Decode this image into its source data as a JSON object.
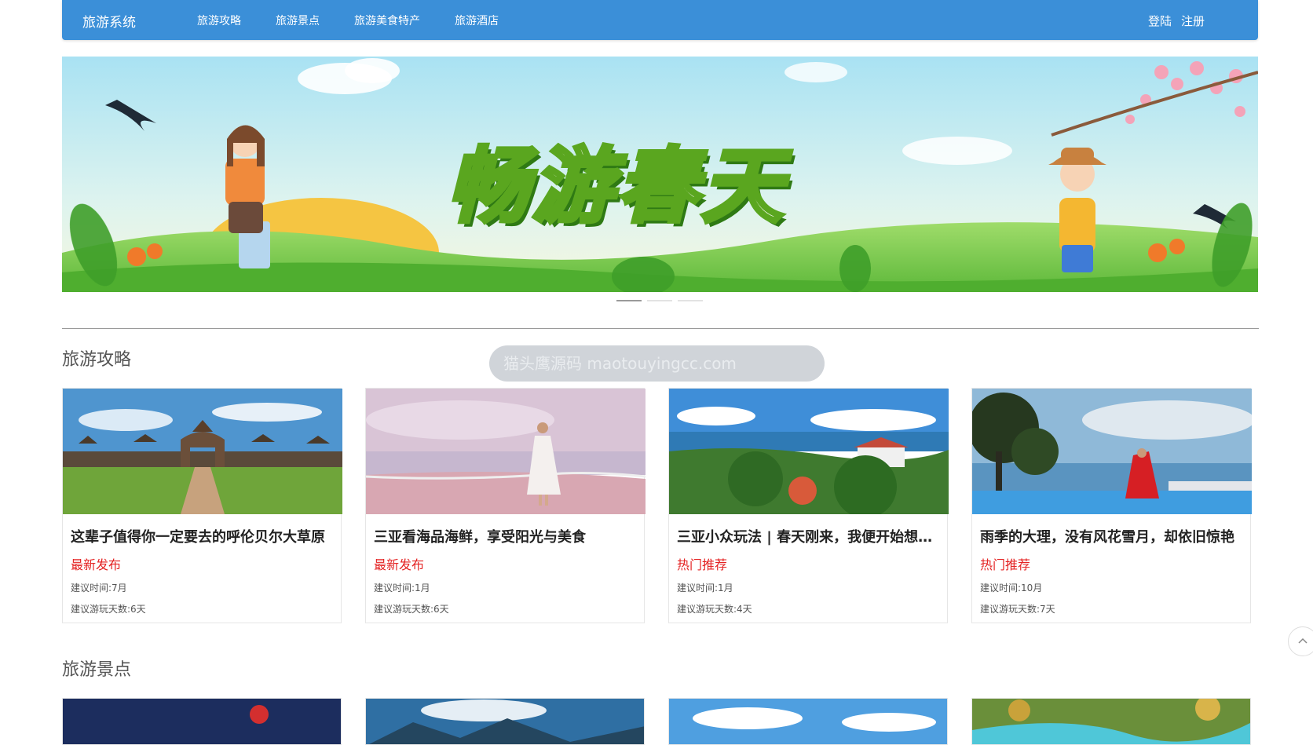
{
  "nav": {
    "brand": "旅游系统",
    "links": [
      "旅游攻略",
      "旅游景点",
      "旅游美食特产",
      "旅游酒店"
    ],
    "login": "登陆",
    "register": "注册"
  },
  "banner": {
    "headline": "畅游春天",
    "slide_count": 3,
    "active_slide": 1
  },
  "watermark": "猫头鹰源码 maotouyingcc.com",
  "sections": {
    "guides": {
      "title": "旅游攻略",
      "items": [
        {
          "title": "这辈子值得你一定要去的呼伦贝尔大草原",
          "tag": "最新发布",
          "time": "建议时间:7月",
          "days": "建议游玩天数:6天"
        },
        {
          "title": "三亚看海品海鲜，享受阳光与美食",
          "tag": "最新发布",
          "time": "建议时间:1月",
          "days": "建议游玩天数:6天"
        },
        {
          "title": "三亚小众玩法 | 春天刚来，我便开始想念海了",
          "tag": "热门推荐",
          "time": "建议时间:1月",
          "days": "建议游玩天数:4天"
        },
        {
          "title": "雨季的大理，没有风花雪月，却依旧惊艳",
          "tag": "热门推荐",
          "time": "建议时间:10月",
          "days": "建议游玩天数:7天"
        }
      ]
    },
    "spots": {
      "title": "旅游景点"
    }
  },
  "colors": {
    "navbar": "#3b8fd8",
    "tag": "#e42323"
  }
}
